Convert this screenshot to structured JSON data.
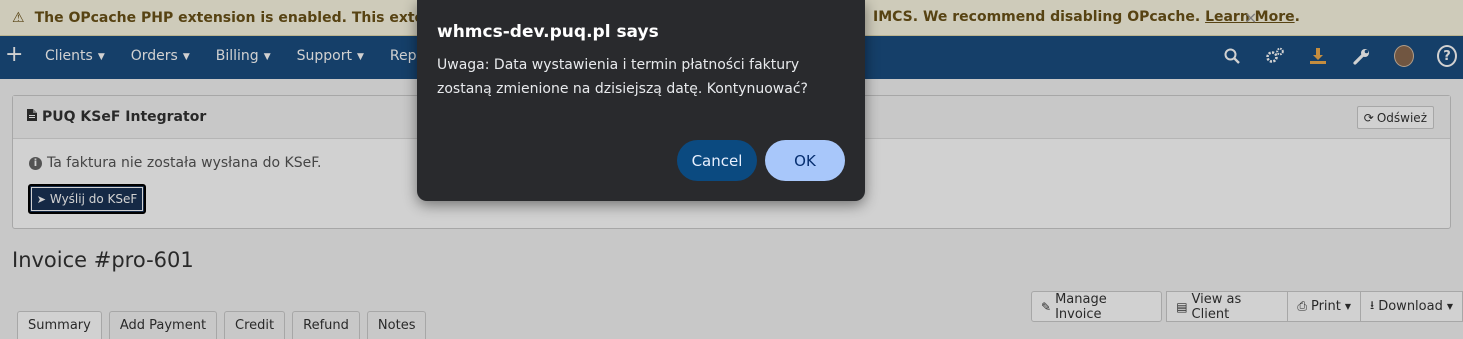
{
  "warning": {
    "icon": "warning-icon",
    "text_left": "The OPcache PHP extension is enabled. This extension can",
    "text_right": "IMCS. We recommend disabling OPcache.",
    "link": "Learn More",
    "link_suffix": ".",
    "close": "×"
  },
  "nav": {
    "plus": "+",
    "items": [
      "Clients",
      "Orders",
      "Billing",
      "Support",
      "Repo"
    ],
    "icons": [
      "search-icon",
      "cogs-icon",
      "download-icon",
      "wrench-icon",
      "avatar",
      "help-icon"
    ],
    "help": "?"
  },
  "panel": {
    "title": "PUQ KSeF Integrator",
    "refresh_label": "Odśwież",
    "info_text": "Ta faktura nie została wysłana do KSeF.",
    "send_button": "Wyślij do KSeF"
  },
  "invoice_title": "Invoice #pro-601",
  "actions": {
    "manage": "Manage Invoice",
    "view_client": "View as Client",
    "print": "Print",
    "download": "Download"
  },
  "tabs": [
    "Summary",
    "Add Payment",
    "Credit",
    "Refund",
    "Notes"
  ],
  "dialog": {
    "title": "whmcs-dev.puq.pl says",
    "message": "Uwaga: Data wystawienia i termin płatności faktury zostaną zmienione na dzisiejszą datę. Kontynuować?",
    "cancel": "Cancel",
    "ok": "OK"
  },
  "colors": {
    "nav_bg": "#1a4d80",
    "warning_bg": "#fcf8e3",
    "dialog_bg": "#292a2d",
    "ok_bg": "#a8c7fa",
    "cancel_bg": "#0b4a80"
  }
}
